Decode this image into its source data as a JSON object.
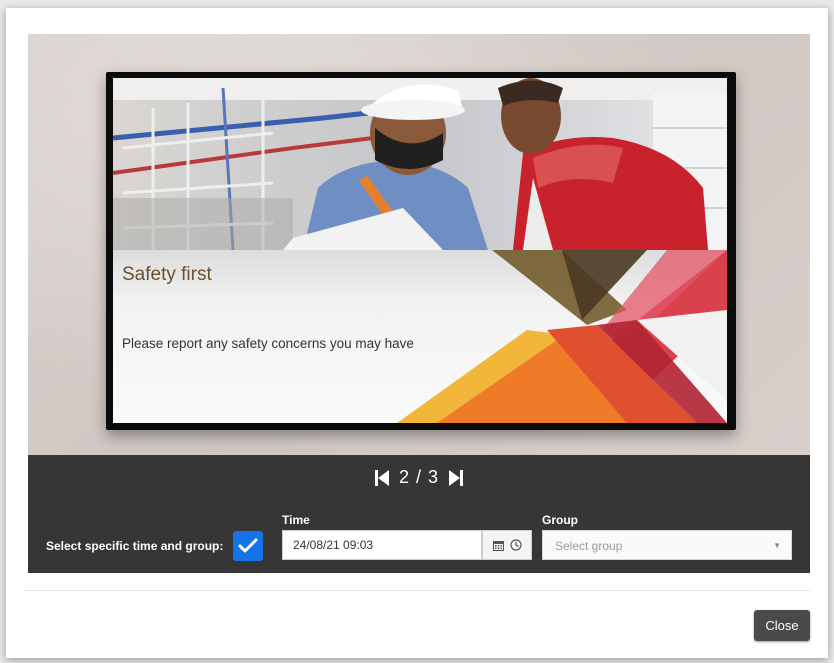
{
  "slide": {
    "title": "Safety first",
    "body": "Please report any safety concerns you may have"
  },
  "pager": {
    "prev_icon": "skip-previous-icon",
    "next_icon": "skip-next-icon",
    "current": "2",
    "total": "3",
    "separator": " / "
  },
  "specific": {
    "label": "Select specific time and group:",
    "checked": true,
    "check_icon": "checkmark-icon"
  },
  "time": {
    "label": "Time",
    "value": "24/08/21 09:03",
    "calendar_icon": "calendar-icon",
    "clock_icon": "clock-icon"
  },
  "group": {
    "label": "Group",
    "placeholder": "Select group"
  },
  "footer": {
    "close_label": "Close"
  },
  "colors": {
    "accent": "#1673e6",
    "control_bar": "#363636",
    "title_brown": "#6b4f2e"
  }
}
